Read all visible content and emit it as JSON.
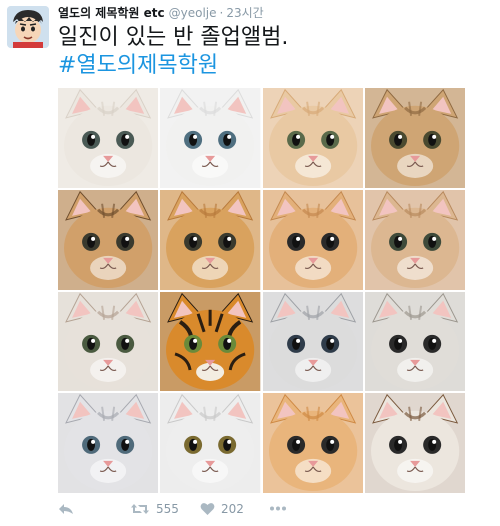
{
  "tweet": {
    "author_name": "열도의 제목학원 etc",
    "handle": "@yeolje",
    "separator": "·",
    "time": "23시간",
    "text": "일진이 있는 반 졸업앨범.",
    "hashtag": "#열도의제목학원"
  },
  "photo_grid": {
    "rows": 4,
    "cols": 4,
    "tiles": [
      {
        "subject": "cream cat",
        "fur": "#ece7e0",
        "accent": "#d9d1c7",
        "eyes": "#4a5a55"
      },
      {
        "subject": "white cat",
        "fur": "#f1f1f0",
        "accent": "#dcdcdc",
        "eyes": "#4f6f80"
      },
      {
        "subject": "pale ginger cat",
        "fur": "#e9c9a3",
        "accent": "#d7aa78",
        "eyes": "#5a6a4a"
      },
      {
        "subject": "tabby cat",
        "fur": "#cfa574",
        "accent": "#8f6a42",
        "eyes": "#4a4a30"
      },
      {
        "subject": "tabby kitten",
        "fur": "#d1a06a",
        "accent": "#6f4e2e",
        "eyes": "#3a3a2e"
      },
      {
        "subject": "ginger kitten",
        "fur": "#d9a25e",
        "accent": "#b87a3c",
        "eyes": "#3a3a2e"
      },
      {
        "subject": "ginger kitten",
        "fur": "#e3b07a",
        "accent": "#c48950",
        "eyes": "#2a2a2a"
      },
      {
        "subject": "ginger kitten",
        "fur": "#dcb791",
        "accent": "#b88a5e",
        "eyes": "#3e4a3a"
      },
      {
        "subject": "calico cat",
        "fur": "#e7e1da",
        "accent": "#b5a394",
        "eyes": "#4a5a40"
      },
      {
        "subject": "tiger",
        "fur": "#d98a2c",
        "accent": "#2a1e12",
        "eyes": "#6a8a3a"
      },
      {
        "subject": "grey kitten",
        "fur": "#dcdcdc",
        "accent": "#9ea1a6",
        "eyes": "#2f3c4a"
      },
      {
        "subject": "grey kitten",
        "fur": "#e0ddd8",
        "accent": "#9c978f",
        "eyes": "#2a2a2a"
      },
      {
        "subject": "grey white cat",
        "fur": "#e3e3e6",
        "accent": "#a7a9b0",
        "eyes": "#4f6a7a"
      },
      {
        "subject": "white cat",
        "fur": "#eeeeee",
        "accent": "#c9c9c9",
        "eyes": "#7a6a30"
      },
      {
        "subject": "ginger kitten",
        "fur": "#e9b57c",
        "accent": "#cf8a45",
        "eyes": "#2a2a2a"
      },
      {
        "subject": "calico kitten",
        "fur": "#ece6de",
        "accent": "#7b5a3e",
        "eyes": "#2a2a2a"
      }
    ]
  },
  "actions": {
    "reply_icon": "reply-icon",
    "retweet_count": "555",
    "like_count": "202",
    "more_icon": "more-icon"
  },
  "colors": {
    "text": "#14171a",
    "muted": "#8899a6",
    "link": "#1b95e0"
  }
}
